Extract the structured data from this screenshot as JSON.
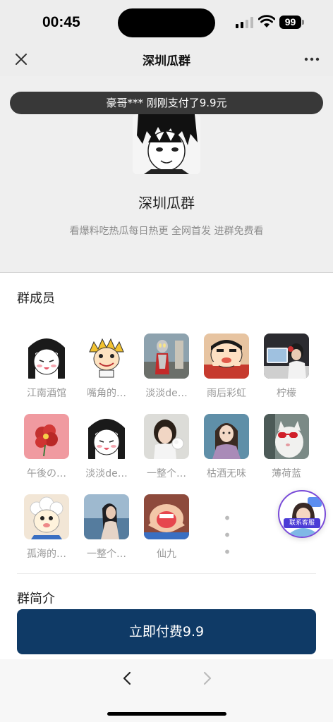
{
  "status_bar": {
    "time": "00:45",
    "battery": "99"
  },
  "nav": {
    "title": "深圳瓜群"
  },
  "toast": {
    "text": "豪哥*** 刚刚支付了9.9元"
  },
  "group": {
    "name": "深圳瓜群",
    "description": "看爆料吃热瓜每日热更 全网首发 进群免费看"
  },
  "members_section": {
    "title": "群成员",
    "members": [
      {
        "name": "江南酒馆",
        "avatar": "girl-cartoon"
      },
      {
        "name": "嘴角的…",
        "avatar": "boy-cartoon"
      },
      {
        "name": "淡淡de…",
        "avatar": "ultraman"
      },
      {
        "name": "雨后彩虹",
        "avatar": "crayon-shin-chan"
      },
      {
        "name": "柠檬",
        "avatar": "girl-desk"
      },
      {
        "name": "午後の…",
        "avatar": "red-flower"
      },
      {
        "name": "淡淡de…",
        "avatar": "girl-cartoon"
      },
      {
        "name": "一整个…",
        "avatar": "girl-photo"
      },
      {
        "name": "枯酒无味",
        "avatar": "girl-illustration"
      },
      {
        "name": "薄荷蓝",
        "avatar": "cat-sunglasses"
      },
      {
        "name": "孤海的…",
        "avatar": "sheep-cartoon"
      },
      {
        "name": "一整个…",
        "avatar": "girl-beach"
      },
      {
        "name": "仙九",
        "avatar": "shouting-cartoon"
      }
    ],
    "more_label": "• • •"
  },
  "support": {
    "label": "联系客服"
  },
  "intro_section": {
    "title": "群简介"
  },
  "pay_button": {
    "label": "立即付费9.9"
  },
  "colors": {
    "pay_button": "#0f3a66",
    "toast_bg": "#383838",
    "support_accent": "#4b3bd6"
  }
}
